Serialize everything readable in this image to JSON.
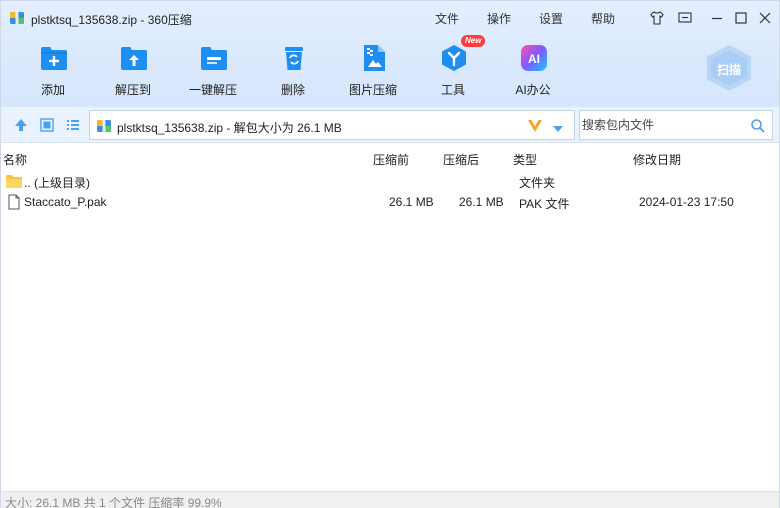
{
  "titlebar": {
    "title": "plstktsq_135638.zip - 360压缩",
    "menu": [
      "文件",
      "操作",
      "设置",
      "帮助"
    ]
  },
  "toolbar": {
    "items": [
      {
        "label": "添加",
        "icon": "add-folder-icon"
      },
      {
        "label": "解压到",
        "icon": "extract-to-icon"
      },
      {
        "label": "一键解压",
        "icon": "one-click-extract-icon"
      },
      {
        "label": "删除",
        "icon": "delete-bin-icon"
      },
      {
        "label": "图片压缩",
        "icon": "image-compress-icon"
      },
      {
        "label": "工具",
        "icon": "tools-icon",
        "badge": "New"
      },
      {
        "label": "AI办公",
        "icon": "ai-office-icon",
        "icon_text": "AI"
      }
    ],
    "scan_label": "扫描"
  },
  "address": {
    "path": "plstktsq_135638.zip - 解包大小为 26.1 MB",
    "search_placeholder": "搜索包内文件"
  },
  "columns": {
    "name": "名称",
    "packed": "压缩前",
    "unpacked": "压缩后",
    "type": "类型",
    "modified": "修改日期"
  },
  "rows": [
    {
      "name": ".. (上级目录)",
      "before": "",
      "after": "",
      "type": "文件夹",
      "date": "",
      "icon": "folder-icon"
    },
    {
      "name": "Staccato_P.pak",
      "before": "26.1 MB",
      "after": "26.1 MB",
      "type": "PAK 文件",
      "date": "2024-01-23 17:50",
      "icon": "file-icon"
    }
  ],
  "status": {
    "text": "大小: 26.1 MB 共 1 个文件 压缩率 99.9%"
  },
  "colors": {
    "accent": "#1e8ff0",
    "toolbar_bg": "#dbe9fd",
    "status_text": "#8a8a8a"
  }
}
